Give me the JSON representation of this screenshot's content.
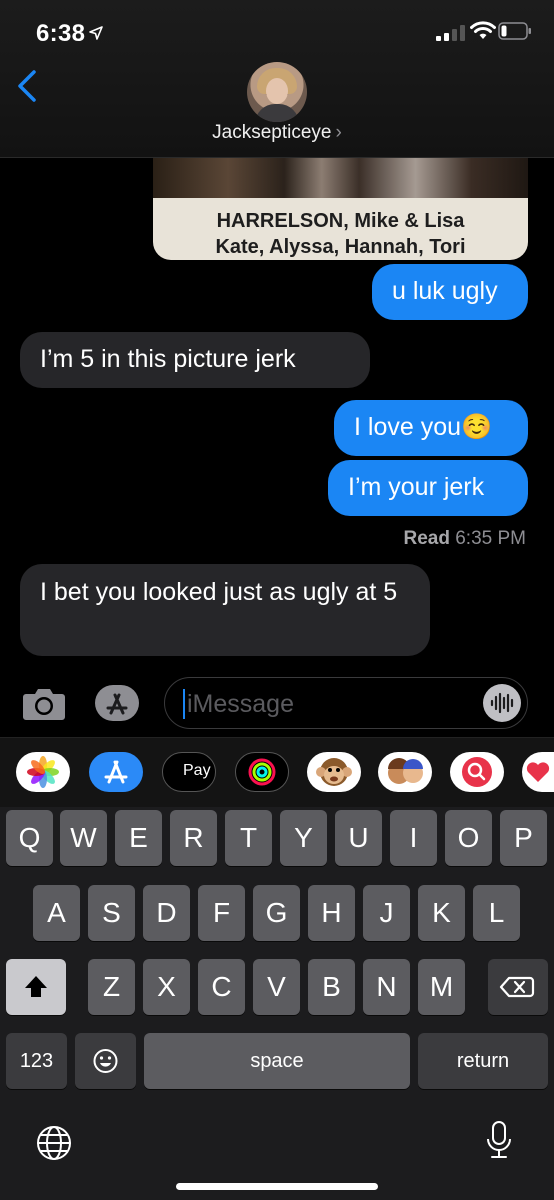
{
  "status_bar": {
    "time": "6:38"
  },
  "header": {
    "contact_name": "Jacksepticeye",
    "chevron": "›"
  },
  "photo": {
    "caption_line1": "HARRELSON, Mike & Lisa",
    "caption_line2": "Kate, Alyssa, Hannah, Tori"
  },
  "messages": [
    {
      "direction": "outgoing",
      "text": "u luk ugly"
    },
    {
      "direction": "incoming",
      "text": "I’m 5 in this picture jerk"
    },
    {
      "direction": "outgoing",
      "text": "I love you☺️"
    },
    {
      "direction": "outgoing",
      "text": "I’m your jerk"
    },
    {
      "direction": "incoming",
      "text": "I bet you looked just as ugly at 5"
    }
  ],
  "read_receipt": {
    "label": "Read",
    "time": "6:35 PM"
  },
  "input": {
    "placeholder": "iMessage"
  },
  "apps": [
    {
      "name": "photos-icon"
    },
    {
      "name": "app-store-icon"
    },
    {
      "name": "apple-pay-icon",
      "label": "Pay"
    },
    {
      "name": "activity-icon"
    },
    {
      "name": "animoji-icon"
    },
    {
      "name": "memoji-icon"
    },
    {
      "name": "search-images-icon"
    },
    {
      "name": "heart-sticker-icon"
    }
  ],
  "keyboard": {
    "row1": [
      "Q",
      "W",
      "E",
      "R",
      "T",
      "Y",
      "U",
      "I",
      "O",
      "P"
    ],
    "row2": [
      "A",
      "S",
      "D",
      "F",
      "G",
      "H",
      "J",
      "K",
      "L"
    ],
    "row3": [
      "Z",
      "X",
      "C",
      "V",
      "B",
      "N",
      "M"
    ],
    "numbers": "123",
    "space": "space",
    "return": "return"
  },
  "colors": {
    "outgoing": "#1b86f4",
    "incoming": "#262629",
    "accent": "#1b86f4"
  }
}
